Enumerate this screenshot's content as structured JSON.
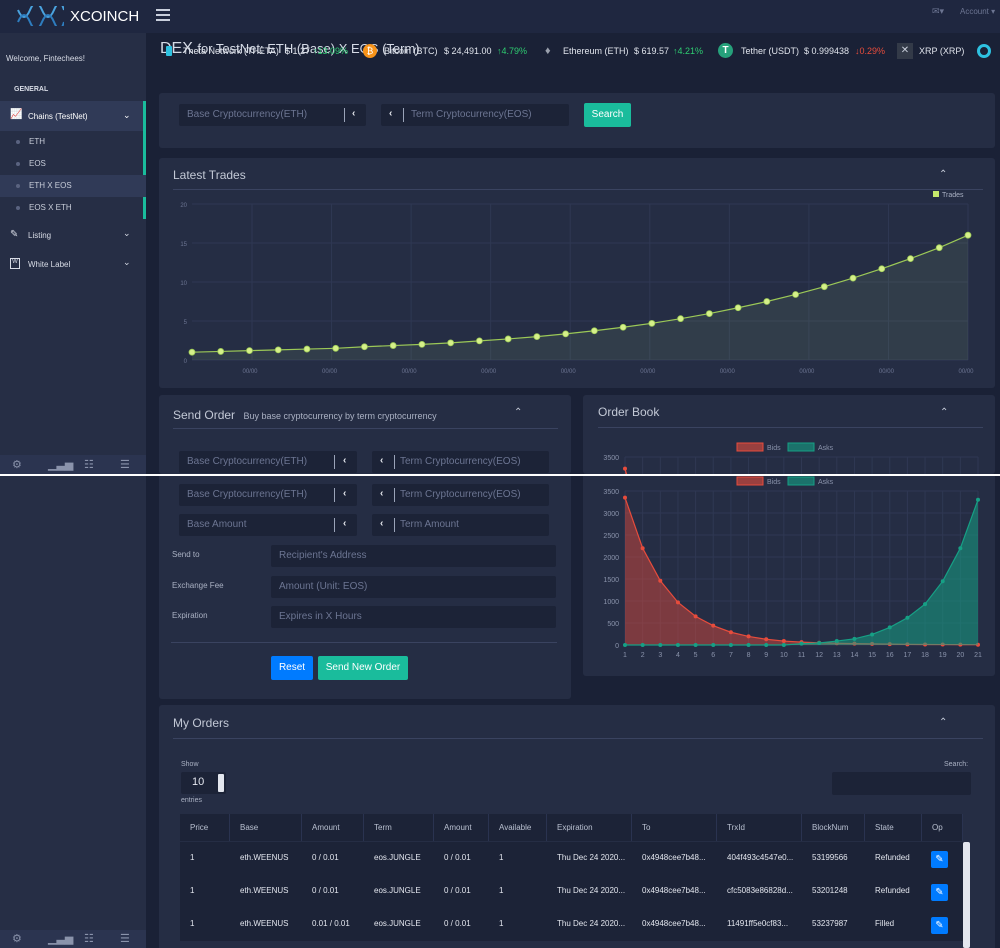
{
  "brand": {
    "name": "XCOINCH"
  },
  "header": {
    "account": "Account",
    "mail_icon": "mail-icon"
  },
  "sidebar": {
    "welcome": "Welcome, Fintechees!",
    "section": "GENERAL",
    "chains_label": "Chains (TestNet)",
    "subitems": [
      "ETH",
      "EOS",
      "ETH X EOS",
      "EOS X ETH"
    ],
    "listing_label": "Listing",
    "white_label": "White Label"
  },
  "page": {
    "title": "DEX",
    "subtitle": "for TestNet: ETH (Base) X EOS (Term)"
  },
  "ticker": [
    {
      "name": "Theta Network (THETA)",
      "price": "$ 1.27",
      "change": "↑13.09%",
      "dir": "up"
    },
    {
      "name": "Bitcoin (BTC)",
      "price": "$ 24,491.00",
      "change": "↑4.79%",
      "dir": "up"
    },
    {
      "name": "Ethereum (ETH)",
      "price": "$ 619.57",
      "change": "↑4.21%",
      "dir": "up"
    },
    {
      "name": "Tether (USDT)",
      "price": "$ 0.999438",
      "change": "↓0.29%",
      "dir": "down"
    },
    {
      "name": "XRP (XRP)",
      "price": "",
      "change": "",
      "dir": ""
    }
  ],
  "search": {
    "base_placeholder": "Base Cryptocurrency(ETH)",
    "term_placeholder": "Term Cryptocurrency(EOS)",
    "button": "Search"
  },
  "latest_trades": {
    "title": "Latest Trades",
    "legend": "Trades"
  },
  "send_order": {
    "title": "Send Order",
    "subtitle": "Buy base cryptocurrency by term cryptocurrency",
    "base_placeholder": "Base Cryptocurrency(ETH)",
    "term_placeholder": "Term Cryptocurrency(EOS)",
    "base_amount": "Base Amount",
    "term_amount": "Term Amount",
    "send_to_label": "Send to",
    "send_to_placeholder": "Recipient's Address",
    "fee_label": "Exchange Fee",
    "fee_placeholder": "Amount (Unit: EOS)",
    "expiration_label": "Expiration",
    "expiration_placeholder": "Expires in X Hours",
    "reset": "Reset",
    "send": "Send New Order"
  },
  "order_book": {
    "title": "Order Book",
    "legend_bids": "Bids",
    "legend_asks": "Asks"
  },
  "my_orders": {
    "title": "My Orders",
    "show": "Show",
    "entries_value": "10",
    "entries": "entries",
    "search_label": "Search:",
    "columns": [
      "Price",
      "Base",
      "Amount",
      "Term",
      "Amount",
      "Available",
      "Expiration",
      "To",
      "TrxId",
      "BlockNum",
      "State",
      "Op"
    ],
    "rows": [
      [
        "1",
        "eth.WEENUS",
        "0 / 0.01",
        "eos.JUNGLE",
        "0 / 0.01",
        "1",
        "Thu Dec 24 2020...",
        "0x4948cee7b48...",
        "404f493c4547e0...",
        "53199566",
        "Refunded"
      ],
      [
        "1",
        "eth.WEENUS",
        "0 / 0.01",
        "eos.JUNGLE",
        "0 / 0.01",
        "1",
        "Thu Dec 24 2020...",
        "0x4948cee7b48...",
        "cfc5083e86828d...",
        "53201248",
        "Refunded"
      ],
      [
        "1",
        "eth.WEENUS",
        "0.01 / 0.01",
        "eos.JUNGLE",
        "0 / 0.01",
        "1",
        "Thu Dec 24 2020...",
        "0x4948cee7b48...",
        "11491ff5e0cf83...",
        "53237987",
        "Filled"
      ]
    ]
  },
  "colors": {
    "accent": "#1abc9c",
    "primary": "#007bff",
    "bids": "#e74c3c",
    "asks": "#16a085",
    "trades": "#c5e86c",
    "up": "#2ecc71",
    "down": "#e74c3c"
  },
  "chart_data": [
    {
      "type": "line",
      "title": "Latest Trades",
      "series": [
        {
          "name": "Trades",
          "values": [
            1,
            1.1,
            1.2,
            1.3,
            1.4,
            1.5,
            1.7,
            1.85,
            2.0,
            2.2,
            2.45,
            2.7,
            3.0,
            3.35,
            3.75,
            4.2,
            4.7,
            5.3,
            5.95,
            6.7,
            7.5,
            8.4,
            9.4,
            10.5,
            11.7,
            13.0,
            14.4,
            16.0
          ]
        }
      ],
      "x_tick_labels": [
        "00/00",
        "00/00",
        "00/00",
        "00/00",
        "00/00",
        "00/00",
        "00/00",
        "00/00",
        "00/00",
        "00/00"
      ],
      "ylim": [
        0,
        20
      ],
      "y_ticks": [
        0,
        5,
        10,
        15,
        20
      ],
      "grid": true,
      "legend": "top-right"
    },
    {
      "type": "area",
      "title": "Order Book",
      "categories": [
        "1",
        "2",
        "3",
        "4",
        "5",
        "6",
        "7",
        "8",
        "9",
        "10",
        "11",
        "12",
        "13",
        "14",
        "15",
        "16",
        "17",
        "18",
        "19",
        "20",
        "21"
      ],
      "series": [
        {
          "name": "Bids",
          "values": [
            3300,
            2200,
            1450,
            970,
            640,
            420,
            280,
            180,
            120,
            75,
            45,
            25,
            15,
            8,
            5,
            3,
            2,
            1,
            1,
            0,
            0
          ]
        },
        {
          "name": "Asks",
          "values": [
            0,
            0,
            0,
            0,
            0,
            1,
            2,
            3,
            5,
            8,
            15,
            25,
            45,
            75,
            120,
            180,
            280,
            420,
            640,
            970,
            1450
          ]
        }
      ],
      "ylim": [
        0,
        3500
      ],
      "y_ticks": [
        0,
        500,
        1000,
        1500,
        2000,
        2500,
        3000,
        3500
      ],
      "grid": true,
      "legend": "top"
    },
    {
      "type": "area",
      "title": "Order Book",
      "categories": [
        "1",
        "2",
        "3",
        "4",
        "5",
        "6",
        "7",
        "8",
        "9",
        "10",
        "11",
        "12",
        "13",
        "14",
        "15",
        "16",
        "17",
        "18",
        "19",
        "20",
        "21"
      ],
      "series": [
        {
          "name": "Bids",
          "values": [
            3350,
            2200,
            1460,
            970,
            650,
            440,
            290,
            195,
            130,
            90,
            65,
            50,
            40,
            32,
            25,
            20,
            15,
            12,
            10,
            8,
            7
          ]
        },
        {
          "name": "Asks",
          "values": [
            0,
            0,
            0,
            0,
            0,
            0,
            0,
            0,
            0,
            0,
            30,
            45,
            90,
            140,
            240,
            400,
            620,
            930,
            1450,
            2200,
            3300
          ]
        }
      ],
      "ylim": [
        0,
        3500
      ],
      "y_ticks": [
        0,
        500,
        1000,
        1500,
        2000,
        2500,
        3000,
        3500
      ],
      "grid": true,
      "legend": "top"
    }
  ]
}
